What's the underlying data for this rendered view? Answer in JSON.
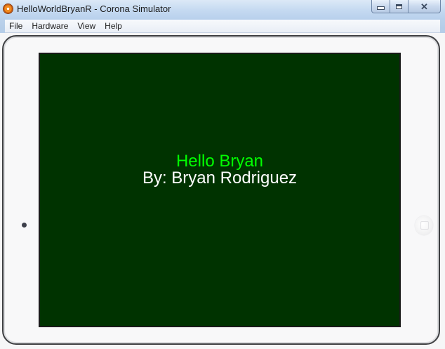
{
  "window": {
    "title": "HelloWorldBryanR - Corona Simulator",
    "controls": {
      "minimize_icon": "minimize-icon",
      "maximize_icon": "maximize-icon",
      "close_icon": "close-icon",
      "close_glyph": "✕"
    }
  },
  "menubar": {
    "items": [
      "File",
      "Hardware",
      "View",
      "Help"
    ]
  },
  "device": {
    "type": "tablet",
    "screen_background": "#003300"
  },
  "app_screen": {
    "greeting": "Hello Bryan",
    "greeting_color": "#00ff00",
    "byline": "By: Bryan Rodriguez",
    "byline_color": "#ffffff"
  }
}
